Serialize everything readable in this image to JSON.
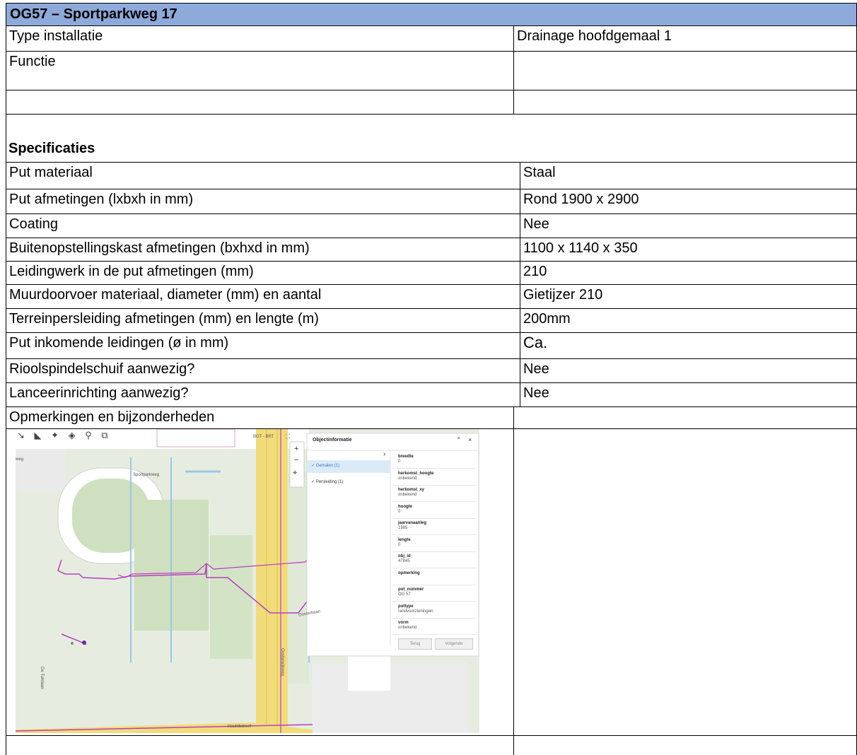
{
  "title": "OG57 – Sportparkweg 17",
  "rows_top": [
    {
      "label": "Type installatie",
      "value": "Drainage hoofdgemaal 1"
    },
    {
      "label": "Functie",
      "value": ""
    },
    {
      "label": "",
      "value": ""
    }
  ],
  "specs_heading": "Specificaties",
  "specs": [
    {
      "label": "Put materiaal",
      "value": "Staal"
    },
    {
      "label": "Put afmetingen (lxbxh in mm)",
      "value": "Rond 1900 x 2900"
    },
    {
      "label": "Coating",
      "value": "Nee"
    },
    {
      "label": "Buitenopstellingskast afmetingen (bxhxd in mm)",
      "value": "1100 x 1140 x 350"
    },
    {
      "label": "Leidingwerk in de put afmetingen (mm)",
      "value": "210"
    },
    {
      "label": "Muurdoorvoer materiaal, diameter (mm) en aantal",
      "value": "Gietijzer 210"
    },
    {
      "label": "Terreinpersleiding afmetingen (mm) en lengte (m)",
      "value": "200mm"
    },
    {
      "label": "Put inkomende leidingen (ø in mm)",
      "value": "Ca."
    },
    {
      "label": "Rioolspindelschuif aanwezig?",
      "value": "Nee"
    },
    {
      "label": "Lanceerinrichting aanwezig?",
      "value": "Nee"
    },
    {
      "label": "Opmerkingen en bijzonderheden",
      "value": ""
    }
  ],
  "map": {
    "layer_select": "BGT - BRT",
    "panel_title": "Objectinformatie",
    "list_items": [
      "Gemalen (1)",
      "Persleiding (1)"
    ],
    "attributes": [
      {
        "key": "breedte",
        "val": "0"
      },
      {
        "key": "herkomst_hoogte",
        "val": "onbekend"
      },
      {
        "key": "herkomst_xy",
        "val": "onbekend"
      },
      {
        "key": "hoogte",
        "val": "0"
      },
      {
        "key": "jaarvanaanleg",
        "val": "1985"
      },
      {
        "key": "lengte",
        "val": "0"
      },
      {
        "key": "obj_id",
        "val": "47845"
      },
      {
        "key": "opmerking",
        "val": ""
      },
      {
        "key": "put_nummer",
        "val": "OG 57"
      },
      {
        "key": "puttype",
        "val": "randvoorzieningen"
      },
      {
        "key": "vorm",
        "val": "onbekend"
      }
    ],
    "btn_back": "Terug",
    "btn_next": "Volgende",
    "street_sportparkweg": "Sportparkweg",
    "street_de_tuiklaan": "De Tuiklaan",
    "street_oosterweg": "Oosterwijkweg",
    "street_oosterbaan": "Oosterbaan",
    "street_bottom": "Houtribdreef",
    "street_left": "weg",
    "colors": {
      "header": "#8eaadb",
      "pipe": "#b83fbf",
      "road": "#f2dc7a",
      "grass": "#cfe0c0"
    }
  }
}
